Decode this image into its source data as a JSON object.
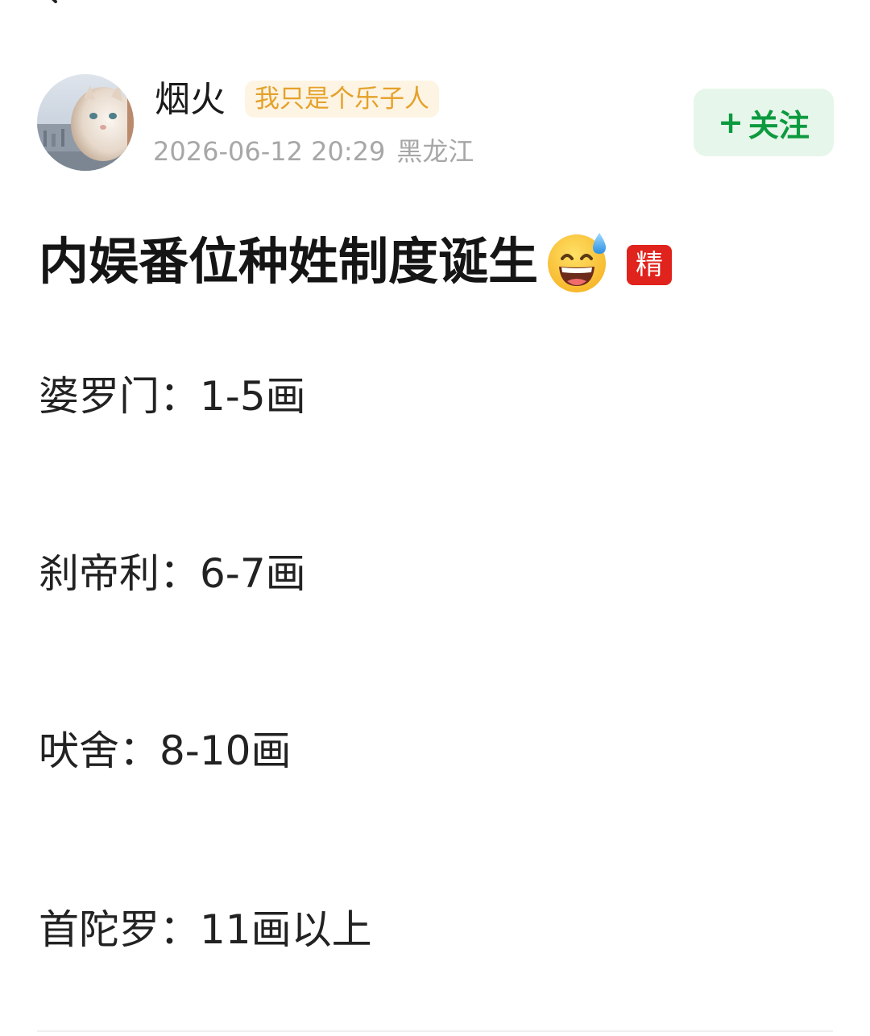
{
  "author": {
    "name": "烟火",
    "tag": "我只是个乐子人",
    "post_time": "2026-06-12 20:29",
    "location": "黑龙江"
  },
  "follow": {
    "plus": "+",
    "label": "关注"
  },
  "post": {
    "title": "内娱番位种姓制度诞生",
    "title_emoji": "grinning-face-with-sweat-icon",
    "featured_badge": "精",
    "lines": [
      "婆罗门：1-5画",
      "刹帝利：6-7画",
      "吠舍：8-10画",
      "首陀罗：11画以上"
    ]
  },
  "colors": {
    "follow_text": "#0c9a3f",
    "follow_bg": "#e7f6ea",
    "tag_text": "#e5a12a",
    "tag_bg": "#fdf4e4",
    "featured_bg": "#e0231c",
    "meta_text": "#a7a7a7"
  }
}
